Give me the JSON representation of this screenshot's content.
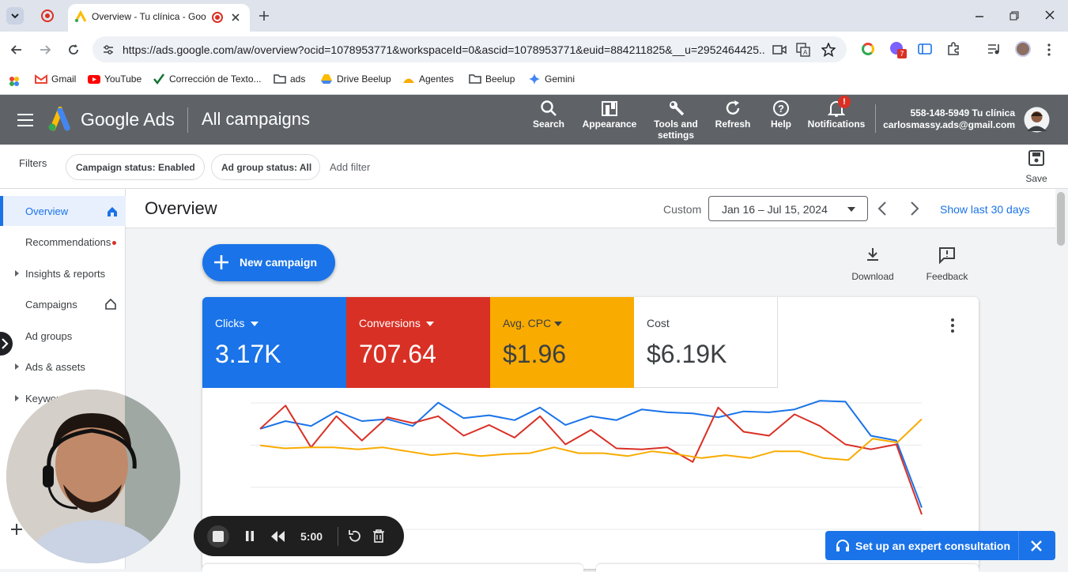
{
  "browser": {
    "tab_title": "Overview - Tu clínica - Goo",
    "url": "https://ads.google.com/aw/overview?ocid=1078953771&workspaceId=0&ascid=1078953771&euid=884211825&__u=2952464425...",
    "extension_badge": "7"
  },
  "bookmarks": [
    {
      "label": "Gmail",
      "icon": "gmail-icon"
    },
    {
      "label": "YouTube",
      "icon": "youtube-icon"
    },
    {
      "label": "Corrección de Texto...",
      "icon": "checkmark-icon"
    },
    {
      "label": "ads",
      "icon": "folder-icon"
    },
    {
      "label": "Drive Beelup",
      "icon": "drive-icon"
    },
    {
      "label": "Agentes",
      "icon": "agents-icon"
    },
    {
      "label": "Beelup",
      "icon": "folder-icon"
    },
    {
      "label": "Gemini",
      "icon": "gemini-icon"
    }
  ],
  "header": {
    "product": "Google Ads",
    "page": "All campaigns",
    "buttons": [
      "Search",
      "Appearance",
      "Tools and settings",
      "Refresh",
      "Help",
      "Notifications"
    ],
    "notification_badge": "!",
    "account_name": "558-148-5949 Tu clínica",
    "account_email": "carlosmassy.ads@gmail.com"
  },
  "filters": {
    "label": "Filters",
    "chips": [
      "Campaign status: Enabled",
      "Ad group status: All"
    ],
    "add_filter": "Add filter",
    "save": "Save"
  },
  "sidebar": {
    "items": [
      {
        "label": "Overview",
        "active": true
      },
      {
        "label": "Recommendations"
      },
      {
        "label": "Insights & reports"
      },
      {
        "label": "Campaigns"
      },
      {
        "label": "Ad groups"
      },
      {
        "label": "Ads & assets"
      },
      {
        "label": "Keywords"
      }
    ]
  },
  "overview": {
    "title": "Overview",
    "range_type": "Custom",
    "date_range": "Jan 16 – Jul 15, 2024",
    "show_last": "Show last 30 days",
    "new_campaign": "New campaign",
    "download": "Download",
    "feedback": "Feedback"
  },
  "metrics": [
    {
      "label": "Clicks",
      "value": "3.17K",
      "color": "#1a73e8"
    },
    {
      "label": "Conversions",
      "value": "707.64",
      "color": "#d93025"
    },
    {
      "label": "Avg. CPC",
      "value": "$1.96",
      "color": "#f9ab00"
    },
    {
      "label": "Cost",
      "value": "$6.19K",
      "color": "#ffffff"
    }
  ],
  "chart_data": {
    "type": "line",
    "series": [
      {
        "name": "Clicks",
        "color": "#1a73e8",
        "values": [
          3.6,
          4.4,
          3.9,
          5.4,
          4.4,
          4.6,
          3.9,
          6.3,
          4.7,
          5.0,
          4.5,
          5.8,
          4.0,
          4.9,
          4.5,
          5.6,
          5.3,
          5.2,
          4.8,
          5.4,
          5.3,
          5.6,
          6.5,
          6.4,
          2.9,
          2.4,
          -4.5
        ]
      },
      {
        "name": "Conversions",
        "color": "#d93025",
        "values": [
          3.6,
          6.0,
          1.7,
          4.9,
          2.4,
          4.8,
          4.2,
          4.9,
          2.9,
          4.0,
          2.7,
          4.9,
          2.0,
          3.5,
          1.6,
          1.5,
          1.7,
          0.2,
          5.8,
          3.3,
          2.9,
          5.1,
          3.9,
          2.0,
          1.5,
          2.0,
          -5.2
        ]
      },
      {
        "name": "Avg. CPC",
        "color": "#f9ab00",
        "values": [
          1.9,
          1.6,
          1.7,
          1.7,
          1.5,
          1.7,
          1.3,
          0.9,
          1.1,
          0.8,
          1.0,
          1.1,
          1.7,
          1.1,
          1.1,
          0.8,
          1.3,
          1.0,
          0.6,
          0.9,
          0.6,
          1.3,
          1.3,
          0.6,
          0.4,
          2.6,
          2.2,
          4.6
        ]
      }
    ]
  },
  "recorder": {
    "time": "5:00"
  },
  "consult": {
    "label": "Set up an expert consultation"
  }
}
